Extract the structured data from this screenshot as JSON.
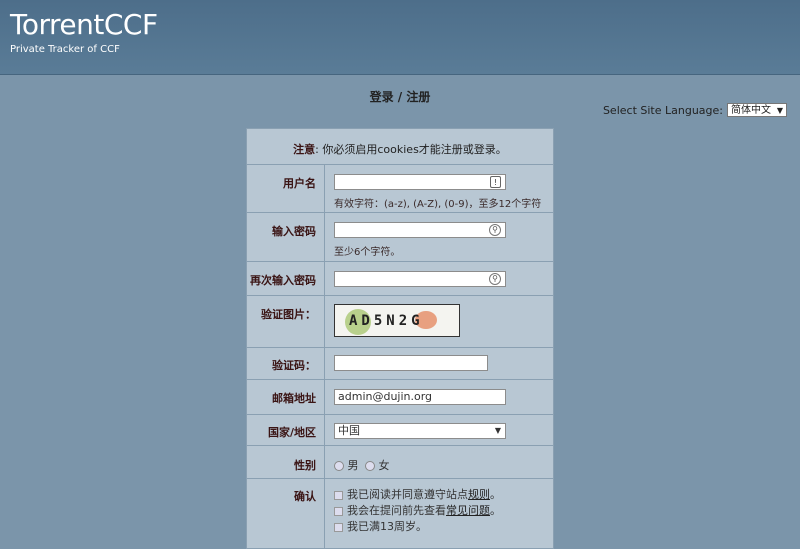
{
  "header": {
    "site_name": "TorrentCCF",
    "slogan": "Private Tracker of CCF"
  },
  "page": {
    "title": "登录 / 注册"
  },
  "language": {
    "label": "Select Site Language:",
    "selected": "简体中文"
  },
  "notice": {
    "label": "注意",
    "text": ": 你必须启用cookies才能注册或登录。"
  },
  "form": {
    "username": {
      "label": "用户名",
      "value": "",
      "hint": "有效字符：(a-z), (A-Z), (0-9)，至多12个字符"
    },
    "password": {
      "label": "输入密码",
      "value": "",
      "hint": "至少6个字符。"
    },
    "password_again": {
      "label": "再次输入密码",
      "value": ""
    },
    "captcha_image": {
      "label": "验证图片：",
      "text": "AD5N2G"
    },
    "captcha_code": {
      "label": "验证码：",
      "value": ""
    },
    "email": {
      "label": "邮箱地址",
      "value": "admin@dujin.org"
    },
    "country": {
      "label": "国家/地区",
      "selected": "中国"
    },
    "gender": {
      "label": "性别",
      "option_male": "男",
      "option_female": "女"
    },
    "confirm": {
      "label": "确认",
      "item1_text": "我已阅读并同意遵守站点",
      "item1_link": "规则",
      "item1_end": "。",
      "item2_text": "我会在提问前先查看",
      "item2_link": "常见问题",
      "item2_end": "。",
      "item3_text": "我已满13周岁。"
    }
  }
}
